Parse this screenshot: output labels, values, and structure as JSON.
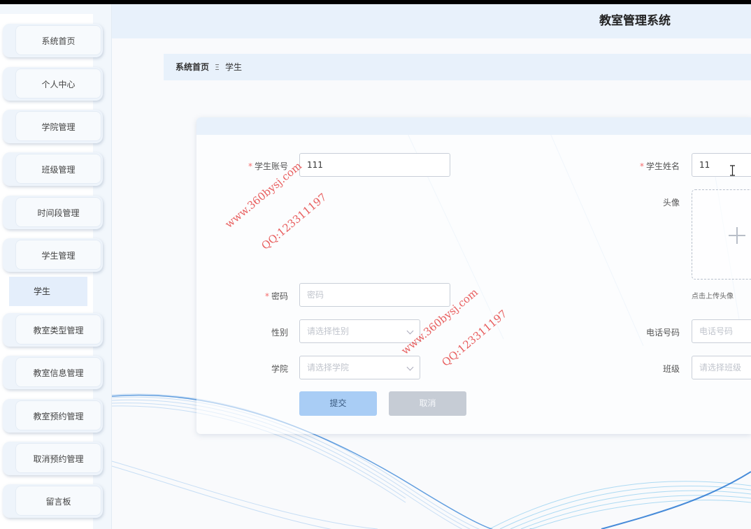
{
  "app": {
    "title": "教室管理系统"
  },
  "sidebar": {
    "items": [
      {
        "label": "系统首页"
      },
      {
        "label": "个人中心"
      },
      {
        "label": "学院管理"
      },
      {
        "label": "班级管理"
      },
      {
        "label": "时间段管理"
      },
      {
        "label": "学生管理"
      },
      {
        "label": "教室类型管理"
      },
      {
        "label": "教室信息管理"
      },
      {
        "label": "教室预约管理"
      },
      {
        "label": "取消预约管理"
      },
      {
        "label": "留言板"
      }
    ],
    "sub_item": {
      "label": "学生"
    }
  },
  "breadcrumb": {
    "home": "系统首页",
    "separator": "Ξ",
    "current": "学生"
  },
  "form": {
    "required_mark": "*",
    "account": {
      "label": "学生账号",
      "value": "111"
    },
    "name": {
      "label": "学生姓名",
      "value": "11"
    },
    "avatar": {
      "label": "头像",
      "tip": "点击上传头像"
    },
    "password": {
      "label": "密码",
      "placeholder": "密码",
      "value": ""
    },
    "gender": {
      "label": "性别",
      "placeholder": "请选择性别"
    },
    "phone": {
      "label": "电话号码",
      "placeholder": "电话号码",
      "value": ""
    },
    "college": {
      "label": "学院",
      "placeholder": "请选择学院"
    },
    "class": {
      "label": "班级",
      "placeholder": "请选择班级"
    },
    "submit_label": "提交",
    "cancel_label": "取消"
  },
  "watermarks": [
    {
      "text": "www.360bysj.com"
    },
    {
      "text": "QQ:123311197"
    },
    {
      "text": "www.360bysj.com"
    },
    {
      "text": "QQ:123311197"
    }
  ],
  "colors": {
    "accent": "#a9cdf5",
    "required": "#f56c6c",
    "header_bg": "#e8f1fb",
    "watermark": "#e12828"
  }
}
